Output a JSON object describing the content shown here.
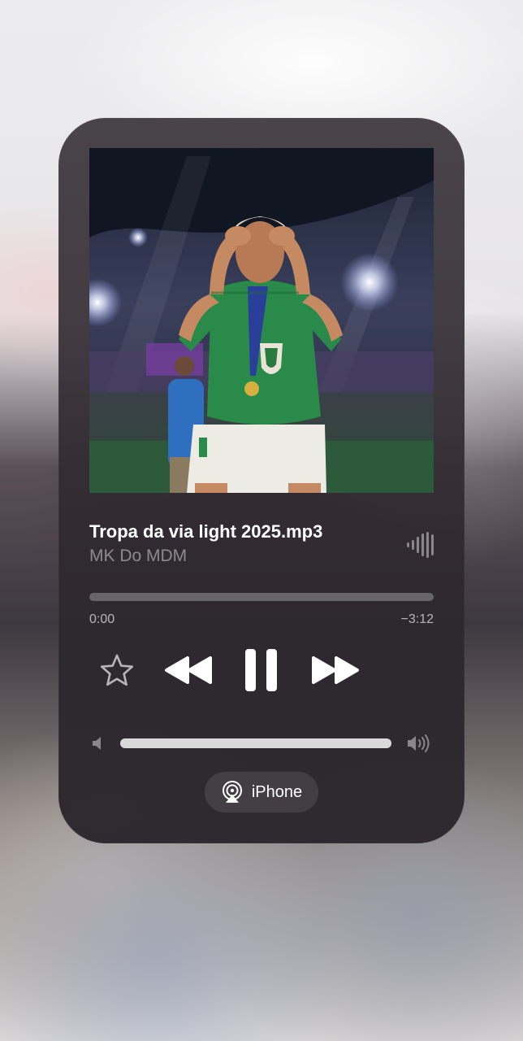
{
  "track": {
    "title": "Tropa da via light 2025.mp3",
    "artist": "MK Do MDM"
  },
  "playback": {
    "elapsed": "0:00",
    "remaining": "−3:12",
    "progress_fraction": 0.0,
    "state": "playing"
  },
  "volume": {
    "level_fraction": 1.0
  },
  "output": {
    "device_label": "iPhone"
  },
  "icons": {
    "favorite": "star-icon",
    "rewind": "rewind-icon",
    "pause": "pause-icon",
    "forward": "fast-forward-icon",
    "volume_low": "speaker-low-icon",
    "volume_high": "speaker-high-icon",
    "airplay": "airplay-icon",
    "waveform": "waveform-icon"
  },
  "colors": {
    "panel": "#322c32",
    "text_primary": "#ffffff",
    "text_secondary": "#8a868a",
    "shirt_green": "#2a8a4a"
  }
}
